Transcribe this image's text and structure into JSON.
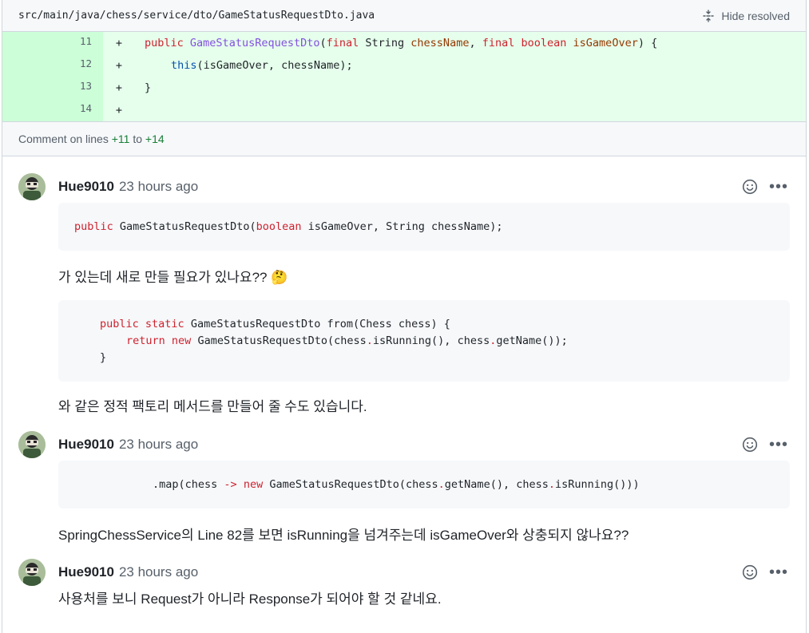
{
  "file": {
    "path": "src/main/java/chess/service/dto/GameStatusRequestDto.java",
    "hide_resolved_label": "Hide resolved"
  },
  "diff": {
    "lines": [
      {
        "num": "11",
        "sign": "+"
      },
      {
        "num": "12",
        "sign": "+"
      },
      {
        "num": "13",
        "sign": "+"
      },
      {
        "num": "14",
        "sign": "+"
      }
    ],
    "tokens": {
      "l11_public": "public",
      "l11_fn": "GameStatusRequestDto",
      "l11_open": "(",
      "l11_final1": "final",
      "l11_string": " String ",
      "l11_p1": "chessName",
      "l11_comma": ", ",
      "l11_final2": "final",
      "l11_sp": " ",
      "l11_bool": "boolean",
      "l11_sp2": " ",
      "l11_p2": "isGameOver",
      "l11_close": ") {",
      "l12_this": "this",
      "l12_rest": "(isGameOver, chessName);",
      "l13": "}"
    }
  },
  "comment_on": {
    "prefix": "Comment on lines ",
    "from": "+11",
    "to_word": " to ",
    "to": "+14"
  },
  "comments": [
    {
      "author": "Hue9010",
      "time": "23 hours ago",
      "code1": {
        "kw1": "public",
        "rest1": " GameStatusRequestDto(",
        "kw2": "boolean",
        "rest2": " isGameOver, String chessName);"
      },
      "text1": "가 있는데 새로 만들 필요가 있나요??",
      "emoji1": "🤔",
      "code2": {
        "l1_kw1": "public",
        "l1_sp": " ",
        "l1_kw2": "static",
        "l1_rest": " GameStatusRequestDto from(Chess chess) {",
        "l2_kw1": "return",
        "l2_sp": " ",
        "l2_kw2": "new",
        "l2_rest1": " GameStatusRequestDto(chess",
        "l2_dot1": ".",
        "l2_rest2": "isRunning(), chess",
        "l2_dot2": ".",
        "l2_rest3": "getName());",
        "l3": "}"
      },
      "text2": "와 같은 정적 팩토리 메서드를 만들어 줄 수도 있습니다."
    },
    {
      "author": "Hue9010",
      "time": "23 hours ago",
      "code": {
        "p1": ".map(chess ",
        "arrow": "->",
        "sp": " ",
        "kw": "new",
        "p2": " GameStatusRequestDto(chess",
        "d1": ".",
        "p3": "getName(), chess",
        "d2": ".",
        "p4": "isRunning()))"
      },
      "text": "SpringChessService의 Line 82를 보면 isRunning을 넘겨주는데 isGameOver와 상충되지 않나요??"
    },
    {
      "author": "Hue9010",
      "time": "23 hours ago",
      "text": "사용처를 보니 Request가 아니라 Response가 되어야 할 것 같네요."
    }
  ],
  "icons": {
    "emoji_reaction": "smiley-icon",
    "more": "kebab-icon",
    "hide_resolved": "fold-icon"
  },
  "colors": {
    "addition_bg": "#e6ffec",
    "addition_num_bg": "#ccffd8",
    "keyword": "#cf222e",
    "function": "#8250df",
    "param": "#953800"
  }
}
